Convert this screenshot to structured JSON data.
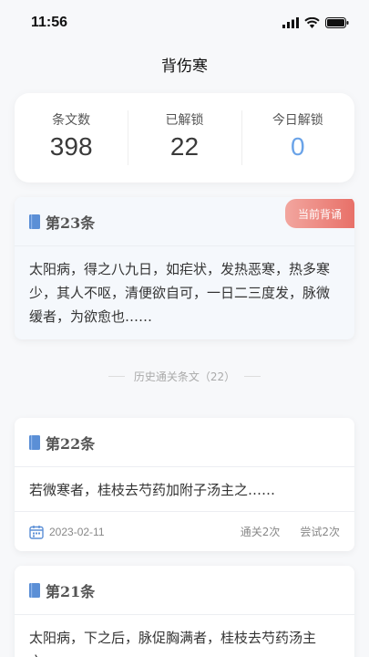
{
  "status": {
    "time": "11:56"
  },
  "nav": {
    "title": "背伤寒"
  },
  "stats": [
    {
      "label": "条文数",
      "value": "398"
    },
    {
      "label": "已解锁",
      "value": "22"
    },
    {
      "label": "今日解锁",
      "value": "0"
    }
  ],
  "current": {
    "title": "第23条",
    "badge": "当前背诵",
    "text": "太阳病，得之八九日，如疟状，发热恶寒，热多寒少，其人不呕，清便欲自可，一日二三度发，脉微缓者，为欲愈也……"
  },
  "history_label": "历史通关条文（22）",
  "history": [
    {
      "title": "第22条",
      "text": "若微寒者，桂枝去芍药加附子汤主之……",
      "date": "2023-02-11",
      "passes": "通关2次",
      "tries": "尝试2次"
    },
    {
      "title": "第21条",
      "text": "太阳病，下之后，脉促胸满者，桂枝去芍药汤主之……"
    }
  ],
  "colors": {
    "accent": "#6aa3e8",
    "badge": "#e87068",
    "book": "#5b8fd6"
  }
}
